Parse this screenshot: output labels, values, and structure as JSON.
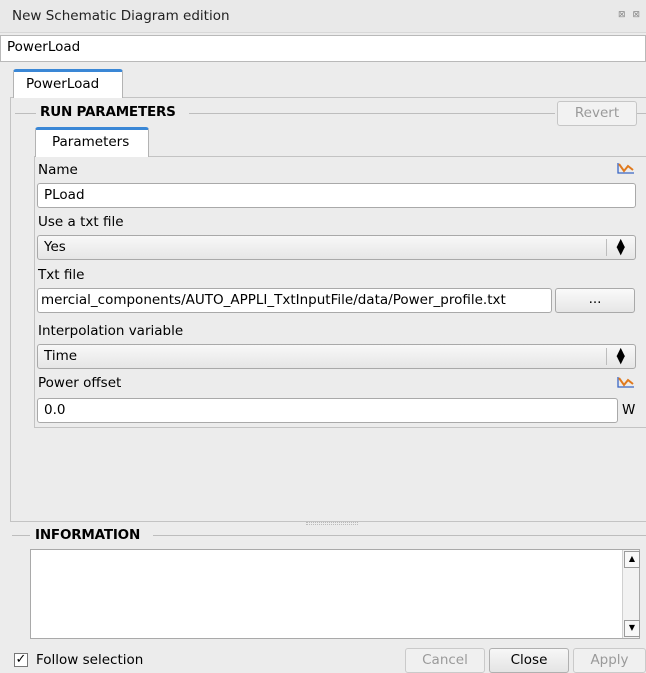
{
  "window": {
    "title": "New Schematic Diagram edition",
    "dock_icons": "⊠ ⊠"
  },
  "component_name": "PowerLoad",
  "outer_tab": "PowerLoad",
  "run_parameters": {
    "title": "RUN PARAMETERS",
    "revert_label": "Revert"
  },
  "inner_tab": "Parameters",
  "fields": {
    "name": {
      "label": "Name",
      "value": "PLoad"
    },
    "use_txt": {
      "label": "Use a txt file",
      "value": "Yes"
    },
    "txt_file": {
      "label": "Txt file",
      "value": "mercial_components/AUTO_APPLI_TxtInputFile/data/Power_profile.txt",
      "browse_label": "..."
    },
    "interpolation": {
      "label": "Interpolation variable",
      "value": "Time"
    },
    "power_offset": {
      "label": "Power offset",
      "value": "0.0",
      "unit": "W"
    }
  },
  "information": {
    "title": "INFORMATION"
  },
  "footer": {
    "follow_label": "Follow selection",
    "follow_checked": "✓",
    "cancel_label": "Cancel",
    "close_label": "Close",
    "apply_label": "Apply"
  },
  "icons": {
    "curve": "chart-curve-icon",
    "accent": "#3a87d6",
    "curve_color": "#e07a1f"
  }
}
